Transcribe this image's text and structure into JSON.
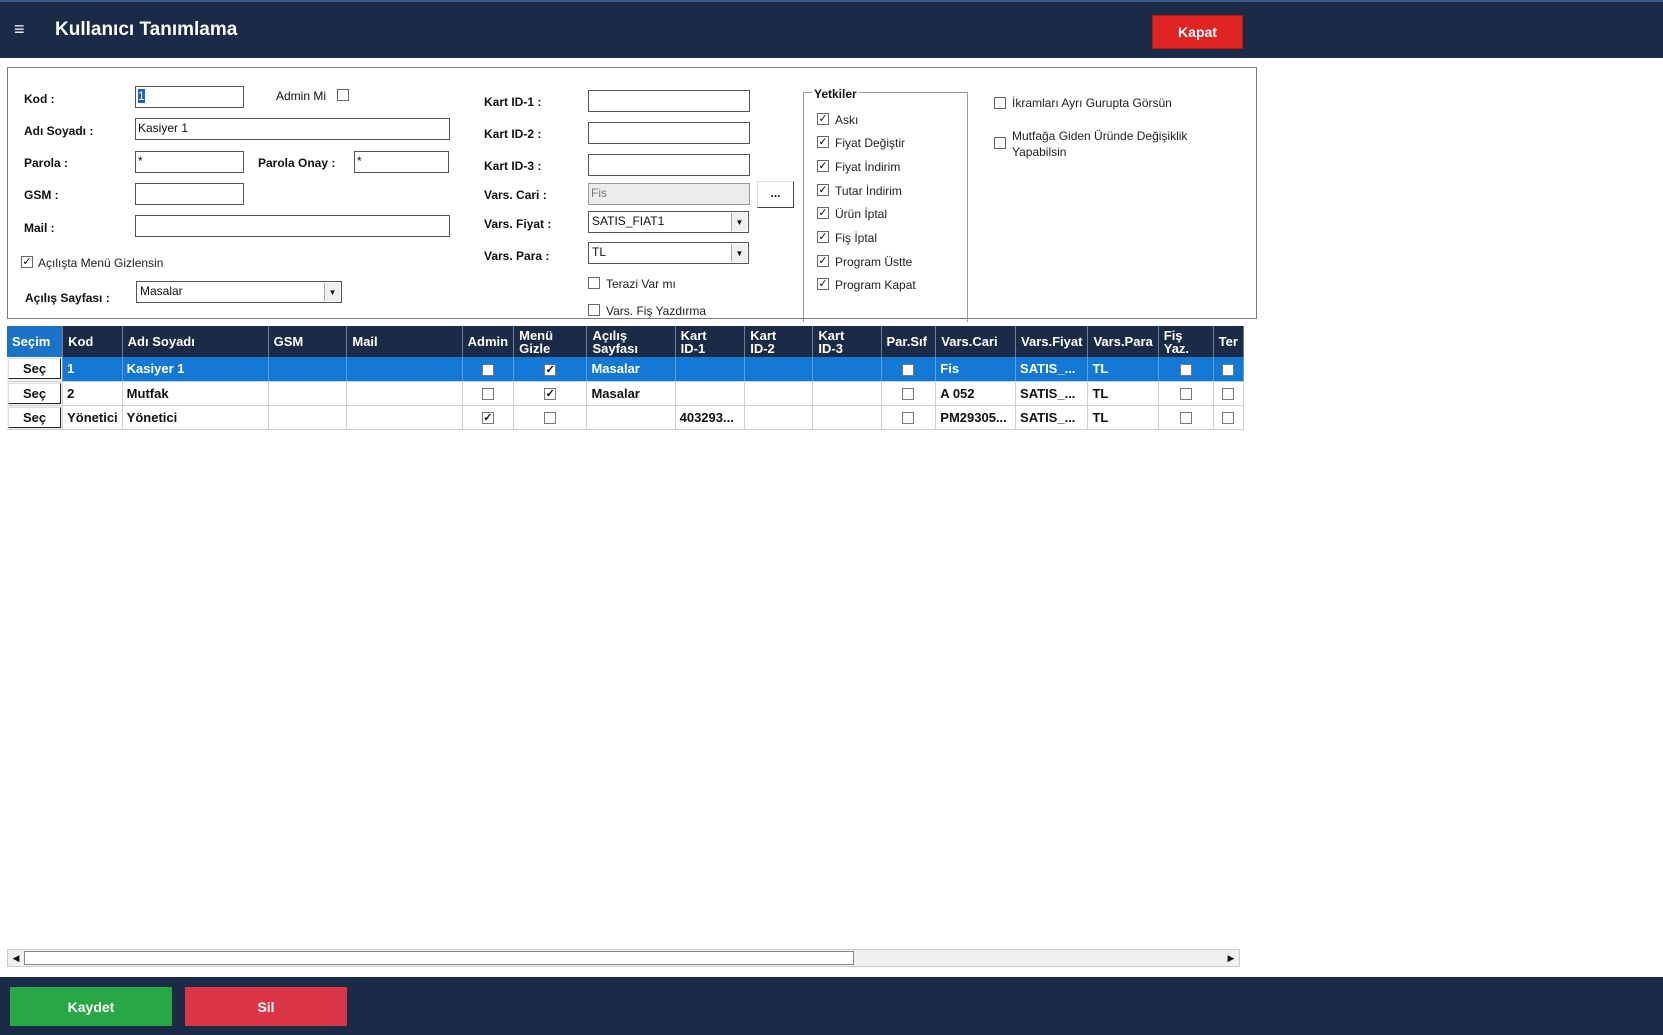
{
  "header": {
    "menu_icon": "≡",
    "title": "Kullanıcı Tanımlama",
    "close_label": "Kapat"
  },
  "form": {
    "kod_label": "Kod :",
    "kod_value": "1",
    "admin_label": "Admin Mi",
    "adsoyad_label": "Adı Soyadı :",
    "adsoyad_value": "Kasiyer 1",
    "parola_label": "Parola :",
    "parola_value": "*",
    "parola_onay_label": "Parola Onay :",
    "parola_onay_value": "*",
    "gsm_label": "GSM :",
    "gsm_value": "",
    "mail_label": "Mail :",
    "mail_value": "",
    "menu_gizle_label": "Açılışta Menü Gizlensin",
    "acilis_label": "Açılış Sayfası :",
    "acilis_value": "Masalar",
    "kart1_label": "Kart ID-1 :",
    "kart2_label": "Kart ID-2 :",
    "kart3_label": "Kart ID-3 :",
    "vars_cari_label": "Vars. Cari :",
    "vars_cari_value": "Fis",
    "browse_label": "...",
    "vars_fiyat_label": "Vars. Fiyat :",
    "vars_fiyat_value": "SATIS_FIAT1",
    "vars_para_label": "Vars. Para :",
    "vars_para_value": "TL",
    "terazi_label": "Terazi Var mı",
    "fis_yazdirma_label": "Vars. Fiş Yazdırma",
    "yetkiler_title": "Yetkiler",
    "yetkiler": [
      "Askı",
      "Fiyat Değiştir",
      "Fiyat İndirim",
      "Tutar İndirim",
      "Ürün İptal",
      "Fiş İptal",
      "Program Üstte",
      "Program Kapat"
    ],
    "ikram_label": "İkramları Ayrı Gurupta Görsün",
    "mutfak_label_1": "Mutfağa Giden Üründe Değişiklik",
    "mutfak_label_2": "Yapabilsin"
  },
  "grid": {
    "columns": [
      "Seçim",
      "Kod",
      "Adı Soyadı",
      "GSM",
      "Mail",
      "Admin",
      "Menü\nGizle",
      "Açılış\nSayfası",
      "Kart\nID-1",
      "Kart\nID-2",
      "Kart\nID-3",
      "Par.Sıf",
      "Vars.Cari",
      "Vars.Fiyat",
      "Vars.Para",
      "Fiş\nYaz.",
      "Ter"
    ],
    "select_label": "Seç",
    "rows": [
      {
        "kod": "1",
        "adsoyad": "Kasiyer 1",
        "gsm": "",
        "mail": "",
        "admin": false,
        "menu_gizle": true,
        "acilis": "Masalar",
        "kart1": "",
        "kart2": "",
        "kart3": "",
        "parsif": false,
        "vars_cari": "Fis",
        "vars_fiyat": "SATIS_...",
        "vars_para": "TL",
        "fis_yaz": false,
        "ter": false
      },
      {
        "kod": "2",
        "adsoyad": "Mutfak",
        "gsm": "",
        "mail": "",
        "admin": false,
        "menu_gizle": true,
        "acilis": "Masalar",
        "kart1": "",
        "kart2": "",
        "kart3": "",
        "parsif": false,
        "vars_cari": "A 052",
        "vars_fiyat": "SATIS_...",
        "vars_para": "TL",
        "fis_yaz": false,
        "ter": false
      },
      {
        "kod": "Yönetici",
        "adsoyad": "Yönetici",
        "gsm": "",
        "mail": "",
        "admin": true,
        "menu_gizle": false,
        "acilis": "",
        "kart1": "403293...",
        "kart2": "",
        "kart3": "",
        "parsif": false,
        "vars_cari": "PM29305...",
        "vars_fiyat": "SATIS_...",
        "vars_para": "TL",
        "fis_yaz": false,
        "ter": false
      }
    ]
  },
  "footer": {
    "save_label": "Kaydet",
    "delete_label": "Sil"
  }
}
